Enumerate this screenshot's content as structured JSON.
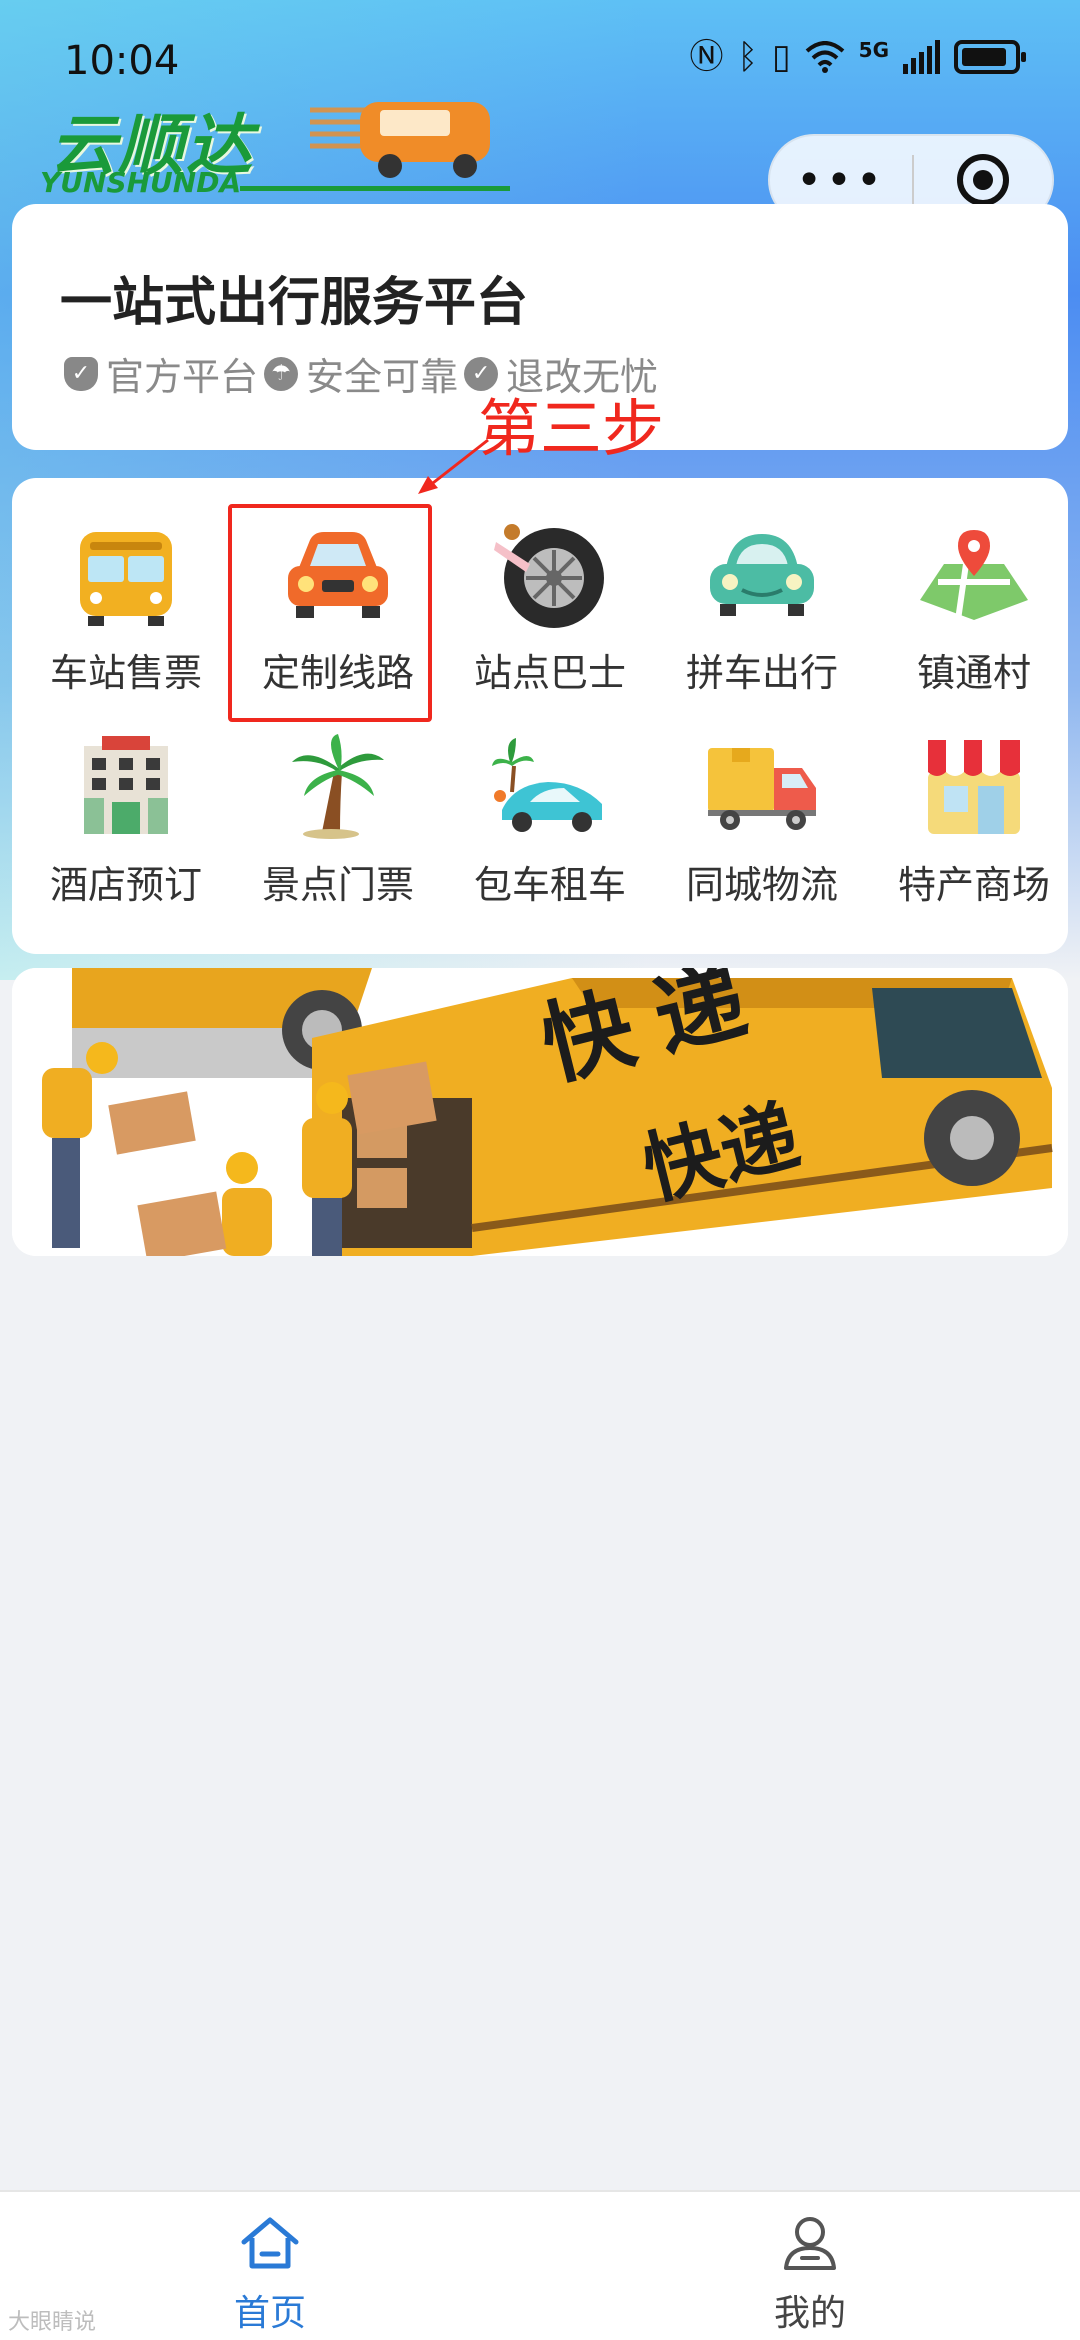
{
  "status": {
    "time": "10:04",
    "network": "5G"
  },
  "brand": {
    "name_cn": "云顺达",
    "name_en": "YUNSHUNDA",
    "color": "#1a9a3a"
  },
  "capsule": {
    "more_icon": "more-dots-icon",
    "close_icon": "target-circle-icon"
  },
  "platform": {
    "title": "一站式出行服务平台",
    "tags": [
      {
        "icon": "shield-icon",
        "label": "官方平台"
      },
      {
        "icon": "umbrella-icon",
        "label": "安全可靠"
      },
      {
        "icon": "check-icon",
        "label": "退改无忧"
      }
    ]
  },
  "annotation": {
    "text": "第三步",
    "color": "#f0281e"
  },
  "services": [
    {
      "label": "车站售票",
      "icon": "bus-icon"
    },
    {
      "label": "定制线路",
      "icon": "orange-car-icon"
    },
    {
      "label": "站点巴士",
      "icon": "tire-icon"
    },
    {
      "label": "拼车出行",
      "icon": "green-car-icon"
    },
    {
      "label": "镇通村",
      "icon": "map-pin-icon"
    },
    {
      "label": "酒店预订",
      "icon": "hotel-icon"
    },
    {
      "label": "景点门票",
      "icon": "palm-tree-icon"
    },
    {
      "label": "包车租车",
      "icon": "rental-car-icon"
    },
    {
      "label": "同城物流",
      "icon": "delivery-truck-icon"
    },
    {
      "label": "特产商场",
      "icon": "shop-icon"
    }
  ],
  "banner": {
    "text_1": "快递",
    "text_2": "快递"
  },
  "tabbar": {
    "items": [
      {
        "label": "首页",
        "icon": "home-icon",
        "active": true
      },
      {
        "label": "我的",
        "icon": "user-icon",
        "active": false
      }
    ],
    "active_color": "#2a7ad6"
  },
  "watermark": "大眼睛说"
}
